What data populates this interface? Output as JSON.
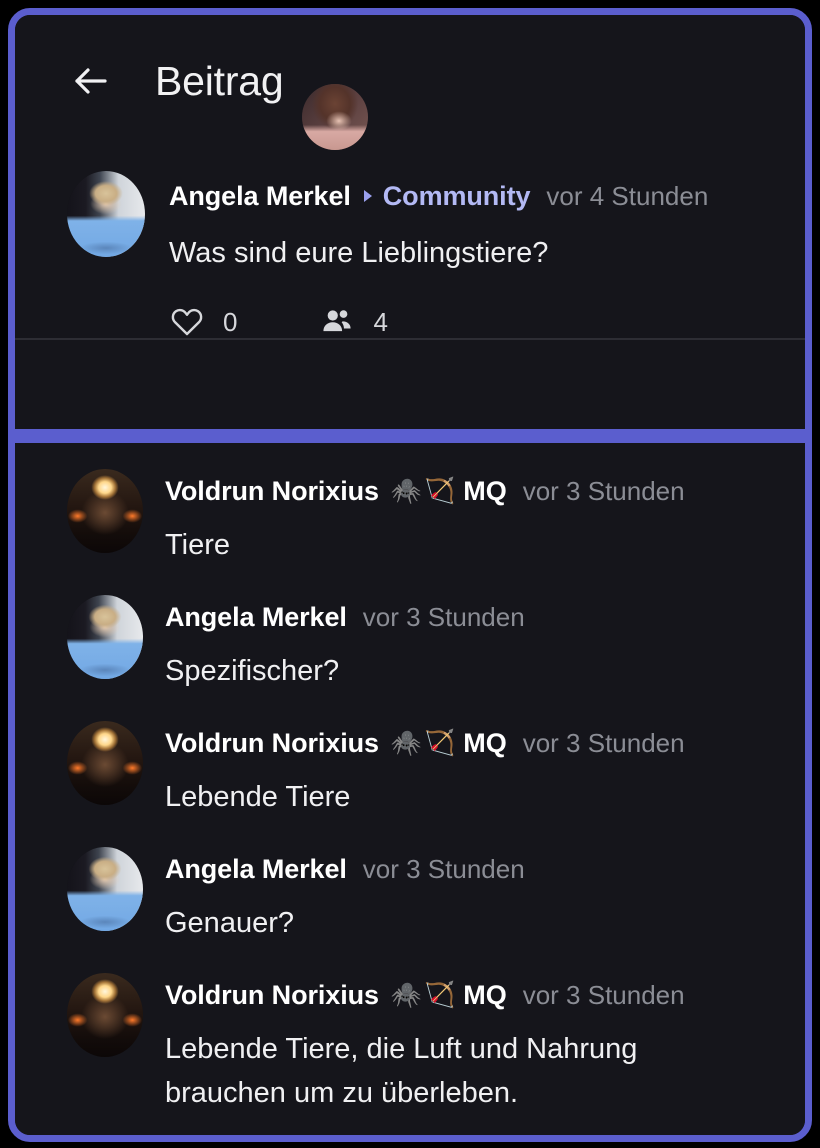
{
  "app": {
    "header": {
      "back_icon": "back-arrow-icon",
      "title": "Beitrag",
      "avatar_alt": "user-profile-avatar"
    }
  },
  "colors": {
    "annotation_purple": "#5b5ece",
    "surface_background": "#15151b",
    "page_background": "#000000",
    "primary_text": "#f0f0f2",
    "secondary_text": "#8b8d95",
    "group_link": "#b3b9f4"
  },
  "post": {
    "author": "Angela Merkel",
    "separator_icon": "triangle-right-icon",
    "group": "Community",
    "timestamp": "vor 4 Stunden",
    "text": "Was sind eure Lieblingstiere?",
    "avatar_art": "merkel-portrait",
    "engagement": [
      {
        "icon": "heart-icon",
        "count": "0",
        "name": "like-count"
      },
      {
        "icon": "people-icon",
        "count": "4",
        "name": "participants-count"
      }
    ]
  },
  "comments": [
    {
      "author": "Voldrun Norixius",
      "badge_emojis": [
        "🕷️",
        "🏹"
      ],
      "badge_tag": "MQ",
      "timestamp": "vor 3 Stunden",
      "text": "Tiere",
      "avatar_art": "flame-artwork"
    },
    {
      "author": "Angela Merkel",
      "badge_emojis": [],
      "badge_tag": "",
      "timestamp": "vor 3 Stunden",
      "text": "Spezifischer?",
      "avatar_art": "merkel-portrait"
    },
    {
      "author": "Voldrun Norixius",
      "badge_emojis": [
        "🕷️",
        "🏹"
      ],
      "badge_tag": "MQ",
      "timestamp": "vor 3 Stunden",
      "text": "Lebende Tiere",
      "avatar_art": "flame-artwork"
    },
    {
      "author": "Angela Merkel",
      "badge_emojis": [],
      "badge_tag": "",
      "timestamp": "vor 3 Stunden",
      "text": "Genauer?",
      "avatar_art": "merkel-portrait"
    },
    {
      "author": "Voldrun Norixius",
      "badge_emojis": [
        "🕷️",
        "🏹"
      ],
      "badge_tag": "MQ",
      "timestamp": "vor 3 Stunden",
      "text": "Lebende Tiere, die Luft und Nahrung\nbrauchen um zu überleben.",
      "avatar_art": "flame-artwork"
    }
  ]
}
